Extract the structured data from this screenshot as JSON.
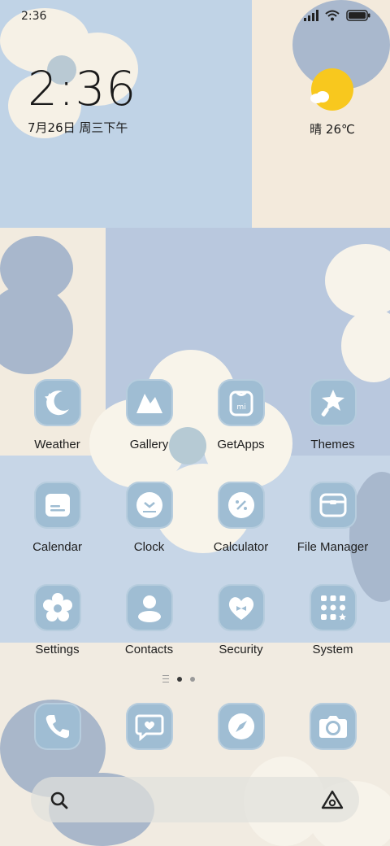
{
  "status_bar": {
    "time": "2:36",
    "icons": [
      "signal-icon",
      "wifi-icon",
      "battery-icon"
    ]
  },
  "clock_widget": {
    "time": "2:36",
    "date": "7月26日 周三下午"
  },
  "weather_widget": {
    "condition_icon": "sun-cloud-icon",
    "text": "晴 26℃",
    "sun_color": "#f8c81e"
  },
  "apps": [
    {
      "label": "Weather",
      "icon": "moon-star-icon"
    },
    {
      "label": "Gallery",
      "icon": "mountain-icon"
    },
    {
      "label": "GetApps",
      "icon": "shopping-bag-icon"
    },
    {
      "label": "Themes",
      "icon": "brush-star-icon"
    },
    {
      "label": "Calendar",
      "icon": "calendar-icon"
    },
    {
      "label": "Clock",
      "icon": "clock-icon"
    },
    {
      "label": "Calculator",
      "icon": "percent-icon"
    },
    {
      "label": "File Manager",
      "icon": "folder-icon"
    },
    {
      "label": "Settings",
      "icon": "gear-flower-icon"
    },
    {
      "label": "Contacts",
      "icon": "person-icon"
    },
    {
      "label": "Security",
      "icon": "heart-bow-icon"
    },
    {
      "label": "System",
      "icon": "app-grid-icon"
    }
  ],
  "page_indicator": {
    "pages": 2,
    "active": 1
  },
  "dock": [
    {
      "name": "phone",
      "icon": "phone-icon"
    },
    {
      "name": "messages",
      "icon": "message-heart-icon"
    },
    {
      "name": "browser",
      "icon": "compass-icon"
    },
    {
      "name": "camera",
      "icon": "camera-icon"
    }
  ],
  "search_bar": {
    "left_icon": "search-icon",
    "right_icon": "lens-icon"
  },
  "colors": {
    "icon_bg": "#9fbdd3",
    "wallpaper_blue": "#bcd0e4",
    "wallpaper_cream": "#f1ece2"
  }
}
